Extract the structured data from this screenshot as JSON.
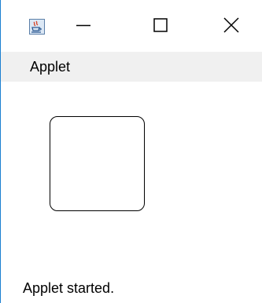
{
  "window": {
    "app_icon": "java-coffee-cup-icon",
    "controls": {
      "minimize_icon": "minimize-icon",
      "maximize_icon": "maximize-icon",
      "close_icon": "close-icon"
    }
  },
  "menubar": {
    "items": [
      {
        "label": "Applet"
      }
    ]
  },
  "canvas": {
    "shape": "rounded-rectangle",
    "stroke_color": "#000000"
  },
  "status_bar": {
    "text": "Applet started."
  },
  "colors": {
    "window_border": "#1a7fd0",
    "menubar_background": "#f0f0f0"
  }
}
